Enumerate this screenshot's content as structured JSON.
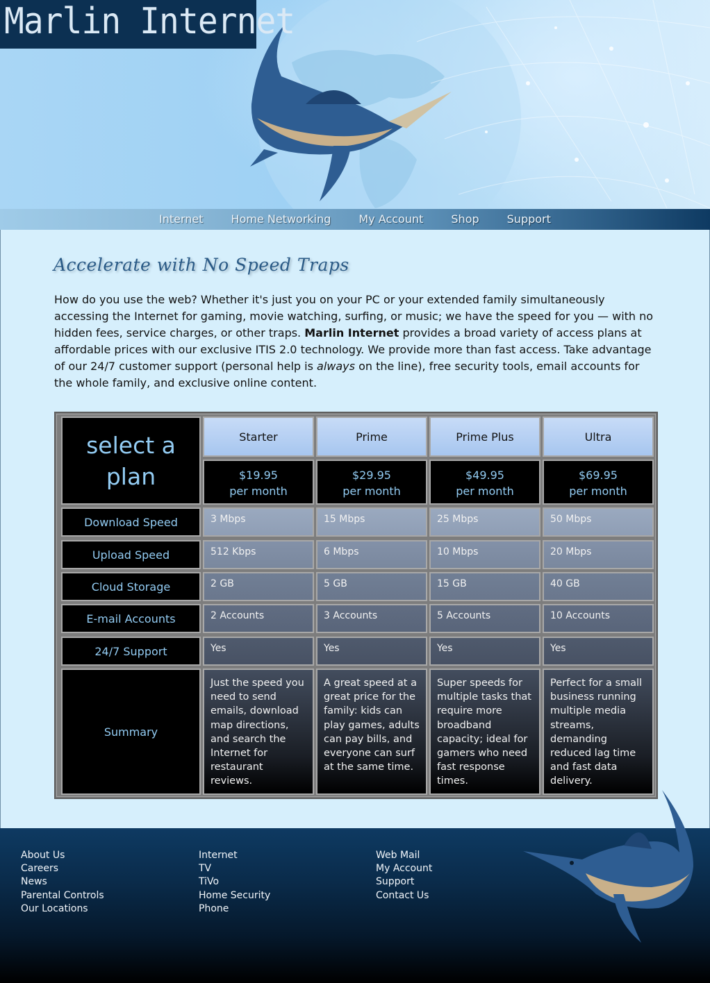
{
  "header": {
    "logo_text": "Marlin Internet",
    "nav": [
      "Internet",
      "Home Networking",
      "My Account",
      "Shop",
      "Support"
    ]
  },
  "main": {
    "heading": "Accelerate with No Speed Traps",
    "intro": {
      "part1": "How do you use the web? Whether it's just you on your PC or your extended family simultaneously accessing the Internet for gaming, movie watching, surfing, or music; we have the speed for you — with no hidden fees, service charges, or other traps. ",
      "brand": "Marlin Internet",
      "part2": " provides a broad variety of access plans at affordable prices with our exclusive ITIS 2.0 technology. We provide more than fast access. Take advantage of our 24/7 customer support (personal help is ",
      "emphasis": "always",
      "part3": " on the line), free security tools, email accounts for the whole family, and exclusive online content."
    }
  },
  "plans": {
    "select_label": "select a plan",
    "names": [
      "Starter",
      "Prime",
      "Prime Plus",
      "Ultra"
    ],
    "prices": [
      "$19.95",
      "$29.95",
      "$49.95",
      "$69.95"
    ],
    "price_suffix": "per month",
    "rows": [
      {
        "label": "Download Speed",
        "values": [
          "3 Mbps",
          "15 Mbps",
          "25 Mbps",
          "50 Mbps"
        ]
      },
      {
        "label": "Upload Speed",
        "values": [
          "512 Kbps",
          "6 Mbps",
          "10 Mbps",
          "20 Mbps"
        ]
      },
      {
        "label": "Cloud Storage",
        "values": [
          "2 GB",
          "5 GB",
          "15 GB",
          "40 GB"
        ]
      },
      {
        "label": "E-mail Accounts",
        "values": [
          "2 Accounts",
          "3 Accounts",
          "5 Accounts",
          "10 Accounts"
        ]
      },
      {
        "label": "24/7 Support",
        "values": [
          "Yes",
          "Yes",
          "Yes",
          "Yes"
        ]
      }
    ],
    "summary_label": "Summary",
    "summaries": [
      "Just the speed you need to send emails, download map directions, and search the Internet for restaurant reviews.",
      "A great speed at a great price for the family: kids can play games, adults can pay bills, and everyone can surf at the same time.",
      "Super speeds for multiple tasks that require more broadband capacity; ideal for gamers who need fast response times.",
      "Perfect for a small business running multiple media streams, demanding reduced lag time and fast data delivery."
    ]
  },
  "footer": {
    "columns": [
      [
        "About Us",
        "Careers",
        "News",
        "Parental Controls",
        "Our Locations"
      ],
      [
        "Internet",
        "TV",
        "TiVo",
        "Home Security",
        "Phone"
      ],
      [
        "Web Mail",
        "My Account",
        "Support",
        "Contact Us"
      ]
    ]
  },
  "colors": {
    "brand_navy": "#0c3052",
    "page_bg": "#d6effc",
    "heading": "#2a5a86",
    "table_text_accent": "#93ccf3"
  }
}
